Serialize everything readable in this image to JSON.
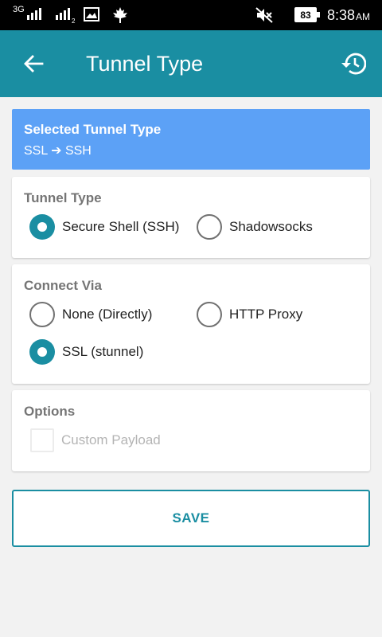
{
  "status_bar": {
    "network": "3G",
    "sim_label": "2",
    "battery": "83",
    "time": "8:38",
    "time_suffix": "AM"
  },
  "app_bar": {
    "title": "Tunnel Type",
    "back_icon": "arrow-left-icon",
    "history_icon": "history-icon"
  },
  "banner": {
    "title": "Selected Tunnel Type",
    "value": "SSL ➔ SSH"
  },
  "tunnel_type": {
    "title": "Tunnel Type",
    "options": [
      {
        "label": "Secure Shell (SSH)",
        "checked": true
      },
      {
        "label": "Shadowsocks",
        "checked": false
      }
    ]
  },
  "connect_via": {
    "title": "Connect Via",
    "options": [
      {
        "label": "None (Directly)",
        "checked": false
      },
      {
        "label": "HTTP Proxy",
        "checked": false
      },
      {
        "label": "SSL (stunnel)",
        "checked": true
      }
    ]
  },
  "options_card": {
    "title": "Options",
    "custom_payload": {
      "label": "Custom Payload",
      "checked": false,
      "enabled": false
    }
  },
  "save_label": "SAVE",
  "colors": {
    "accent": "#1a8ea2",
    "banner": "#5ca1f6",
    "background": "#f2f2f2"
  }
}
